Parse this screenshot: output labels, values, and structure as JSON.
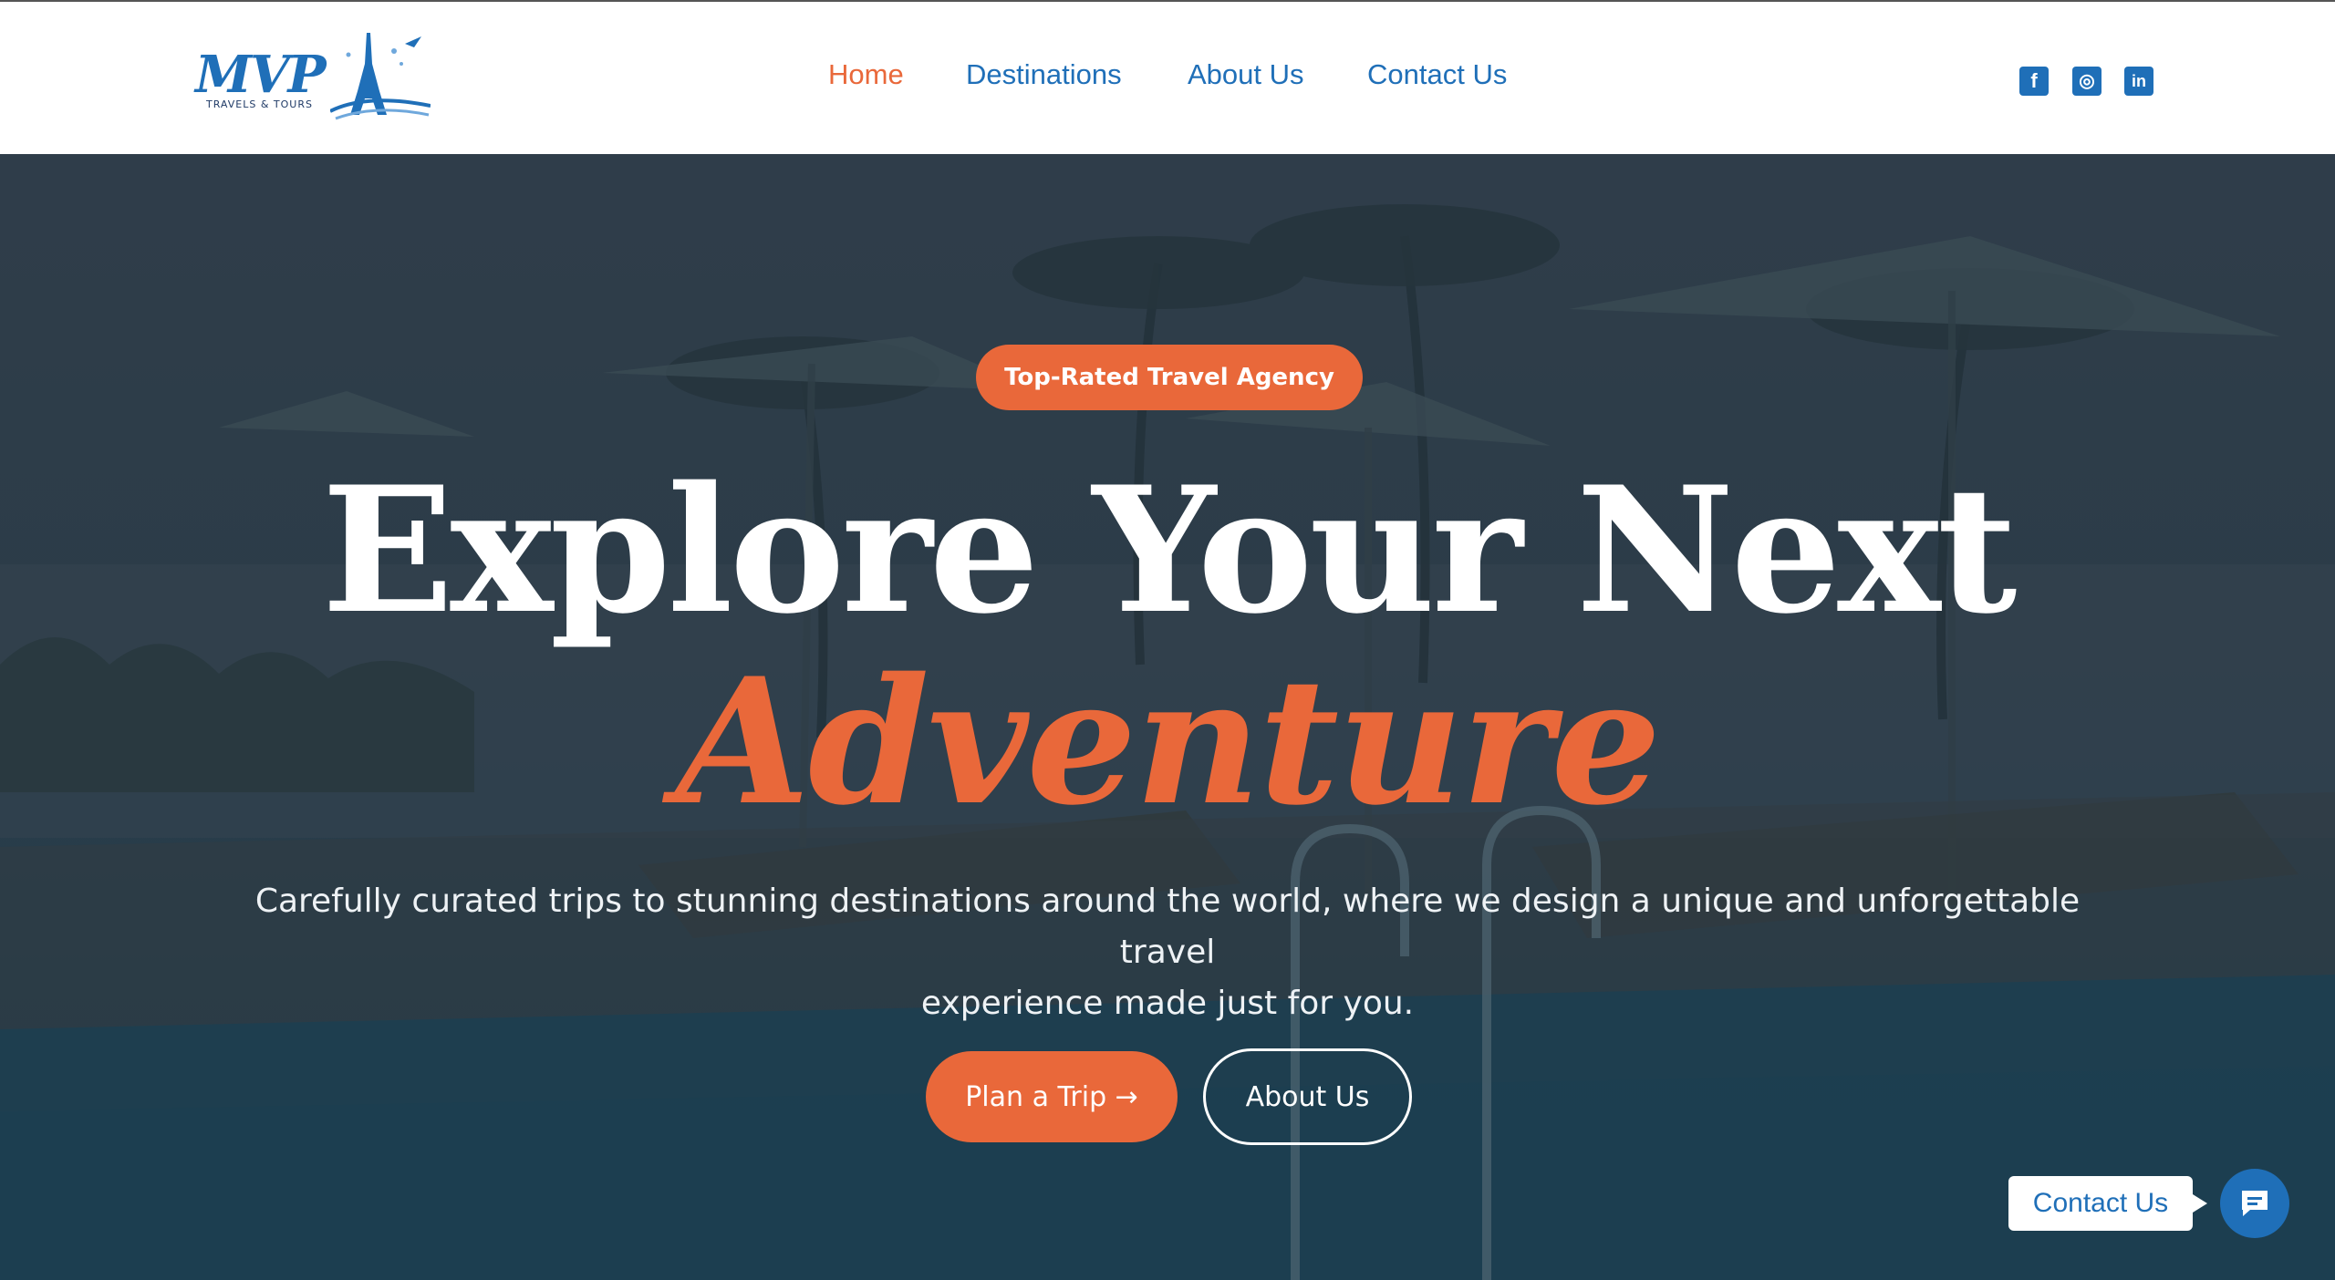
{
  "header": {
    "logo": {
      "brand": "MVP",
      "tagline": "TRAVELS & TOURS"
    },
    "nav": [
      {
        "label": "Home",
        "active": true
      },
      {
        "label": "Destinations",
        "active": false
      },
      {
        "label": "About Us",
        "active": false
      },
      {
        "label": "Contact Us",
        "active": false
      }
    ],
    "social": [
      {
        "icon": "facebook-icon",
        "glyph": "f"
      },
      {
        "icon": "instagram-icon",
        "glyph": "◎"
      },
      {
        "icon": "linkedin-icon",
        "glyph": "in"
      }
    ]
  },
  "hero": {
    "badge": "Top-Rated Travel Agency",
    "headline": "Explore Your Next",
    "headline_accent": "Adventure",
    "description_line1": "Carefully curated trips to stunning destinations around the world, where we design a unique and unforgettable travel",
    "description_line2": "experience made just for you.",
    "primary_button": "Plan a Trip →",
    "secondary_button": "About Us"
  },
  "chat": {
    "label": "Contact Us",
    "icon": "chat-icon"
  },
  "colors": {
    "accent": "#e9683a",
    "brand_blue": "#1f6fb8",
    "header_bg": "#ffffff",
    "hero_overlay": "#2a3f4f"
  }
}
